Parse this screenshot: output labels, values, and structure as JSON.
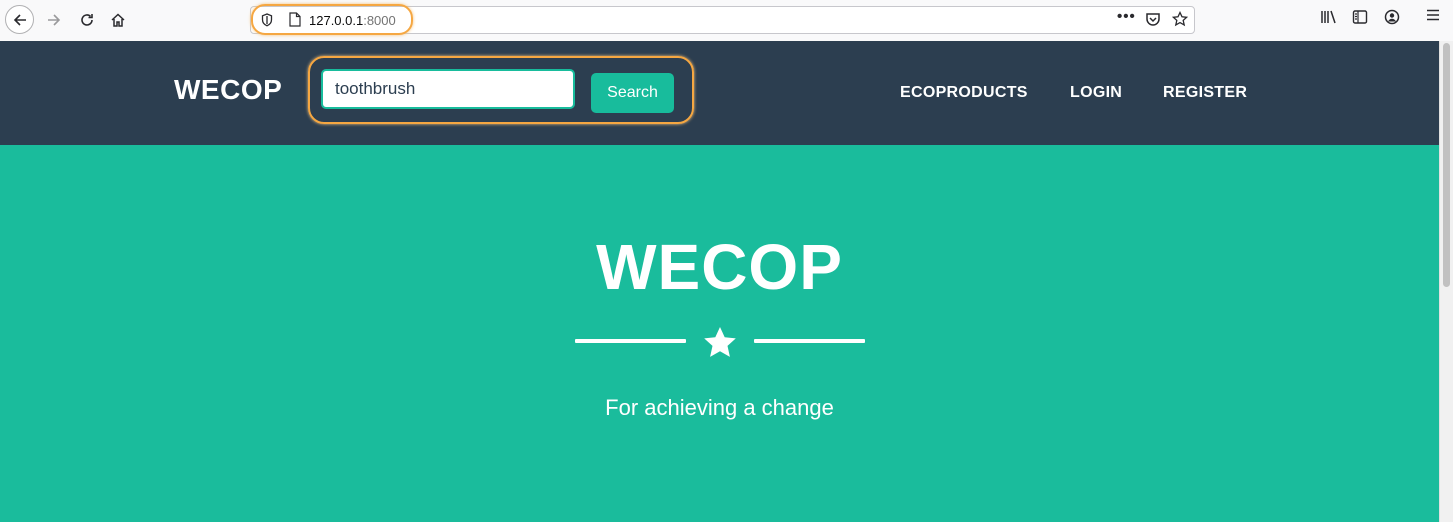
{
  "browser": {
    "url_host": "127.0.0.1",
    "url_port": ":8000",
    "icons": {
      "back": "back-arrow-icon",
      "forward": "forward-arrow-icon",
      "reload": "reload-icon",
      "home": "home-icon",
      "more": "more-icon",
      "pocket": "pocket-icon",
      "bookmark": "star-icon",
      "library": "library-icon",
      "sidebar": "sidebar-icon",
      "account": "account-icon",
      "menu": "hamburger-menu-icon"
    }
  },
  "navbar": {
    "brand": "WECOP",
    "search": {
      "value": "toothbrush",
      "button_label": "Search"
    },
    "links": [
      "ECOPRODUCTS",
      "LOGIN",
      "REGISTER"
    ]
  },
  "hero": {
    "title": "WECOP",
    "subtitle": "For achieving a change"
  },
  "colors": {
    "navbar_bg": "#2c3e50",
    "accent": "#18bc9c",
    "hero_bg": "#1abc9c",
    "highlight": "#f5a742"
  }
}
